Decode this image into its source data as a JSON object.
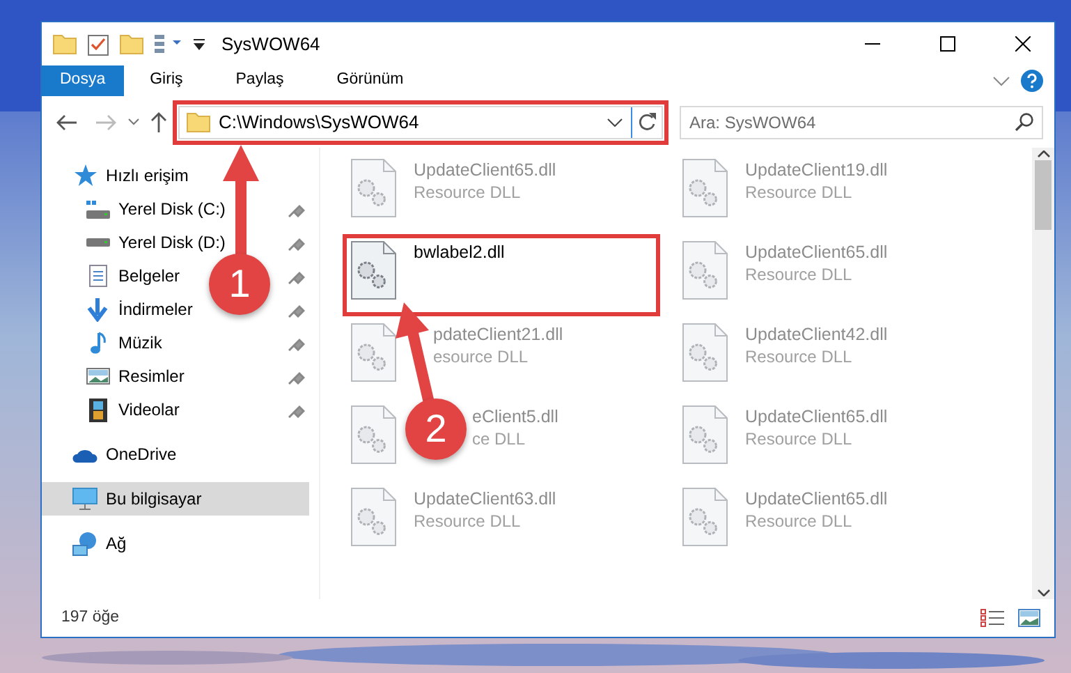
{
  "window": {
    "title": "SysWOW64"
  },
  "ribbon_tabs": [
    {
      "label": "Dosya",
      "kind": "file"
    },
    {
      "label": "Giriş",
      "kind": "tab"
    },
    {
      "label": "Paylaş",
      "kind": "tab"
    },
    {
      "label": "Görünüm",
      "kind": "tab"
    }
  ],
  "address_bar": {
    "path": "C:\\Windows\\SysWOW64",
    "highlighted": true
  },
  "search": {
    "placeholder": "Ara: SysWOW64"
  },
  "navigation": [
    {
      "label": "Hızlı erişim",
      "selected": false,
      "children": [
        {
          "label": "Yerel Disk (C:)",
          "pinned": true,
          "selected": false
        },
        {
          "label": "Yerel Disk (D:)",
          "pinned": true,
          "selected": false
        },
        {
          "label": "Belgeler",
          "pinned": true,
          "selected": false
        },
        {
          "label": "İndirmeler",
          "pinned": true,
          "selected": false
        },
        {
          "label": "Müzik",
          "pinned": true,
          "selected": false
        },
        {
          "label": "Resimler",
          "pinned": true,
          "selected": false
        },
        {
          "label": "Videolar",
          "pinned": true,
          "selected": false
        }
      ]
    },
    {
      "label": "OneDrive",
      "selected": false
    },
    {
      "label": "Bu bilgisayar",
      "selected": true
    },
    {
      "label": "Ağ",
      "selected": false
    }
  ],
  "files": [
    {
      "name": "UpdateClient65.dll",
      "type": "Resource DLL",
      "blurred": true,
      "highlighted": false
    },
    {
      "name": "UpdateClient19.dll",
      "type": "Resource DLL",
      "blurred": true,
      "highlighted": false
    },
    {
      "name": "bwlabel2.dll",
      "blurred": false,
      "highlighted": true
    },
    {
      "name": "UpdateClient65.dll",
      "type": "Resource DLL",
      "blurred": true,
      "highlighted": false
    },
    {
      "name": "pdateClient21.dll",
      "type": "esource DLL",
      "blurred": true,
      "highlighted": false,
      "covered": true
    },
    {
      "name": "UpdateClient42.dll",
      "type": "Resource DLL",
      "blurred": true,
      "highlighted": false
    },
    {
      "name": "eClient5.dll",
      "type": "ce DLL",
      "blurred": true,
      "highlighted": false,
      "covered": true
    },
    {
      "name": "UpdateClient65.dll",
      "type": "Resource DLL",
      "blurred": true,
      "highlighted": false
    },
    {
      "name": "UpdateClient63.dll",
      "type": "Resource DLL",
      "blurred": true,
      "highlighted": false
    },
    {
      "name": "UpdateClient65.dll",
      "type": "Resource DLL",
      "blurred": true,
      "highlighted": false
    }
  ],
  "status_bar": {
    "item_count": "197 öğe"
  },
  "annotations": [
    {
      "number": "1"
    },
    {
      "number": "2"
    }
  ]
}
